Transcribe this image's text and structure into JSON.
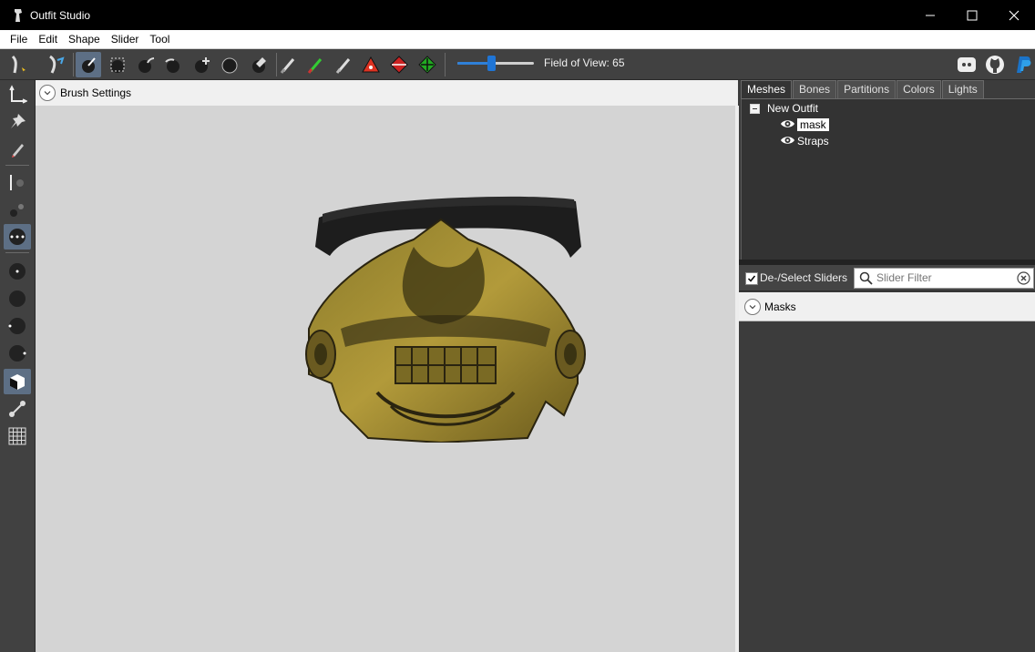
{
  "window": {
    "title": "Outfit Studio",
    "controls": [
      "minimize-icon",
      "maximize-icon",
      "close-icon"
    ]
  },
  "menu": [
    "File",
    "Edit",
    "Shape",
    "Slider",
    "Tool"
  ],
  "toolbar": {
    "fov_label": "Field of View: 65",
    "fov_value": 65,
    "fov_slider_fraction": 0.45,
    "tools": [
      "select-icon",
      "transform-icon",
      "mask-brush-icon",
      "box-select-icon",
      "inflate-brush-icon",
      "deflate-brush-icon",
      "move-brush-icon",
      "smooth-brush-icon",
      "undiff-brush-icon",
      "eraser-icon",
      "weight-brush-icon",
      "color-brush-icon",
      "alpha-brush-icon",
      "collapse-vertex-icon",
      "flip-edge-icon",
      "split-edge-icon"
    ],
    "right_icons": [
      "discord-icon",
      "github-icon",
      "paypal-icon"
    ],
    "accent_color": "#5d6f85"
  },
  "viewport": {
    "brush_settings_label": "Brush Settings",
    "background_color": "#d4d4d4"
  },
  "panel": {
    "tabs": [
      {
        "label": "Meshes",
        "active": true
      },
      {
        "label": "Bones",
        "active": false
      },
      {
        "label": "Partitions",
        "active": false
      },
      {
        "label": "Colors",
        "active": false
      },
      {
        "label": "Lights",
        "active": false
      }
    ],
    "tree": {
      "root": "New Outfit",
      "items": [
        {
          "label": "mask",
          "selected": true
        },
        {
          "label": "Straps",
          "selected": false
        }
      ]
    },
    "deselect_label": "De-/Select Sliders",
    "deselect_checked": true,
    "slider_filter_placeholder": "Slider Filter",
    "masks_label": "Masks"
  }
}
